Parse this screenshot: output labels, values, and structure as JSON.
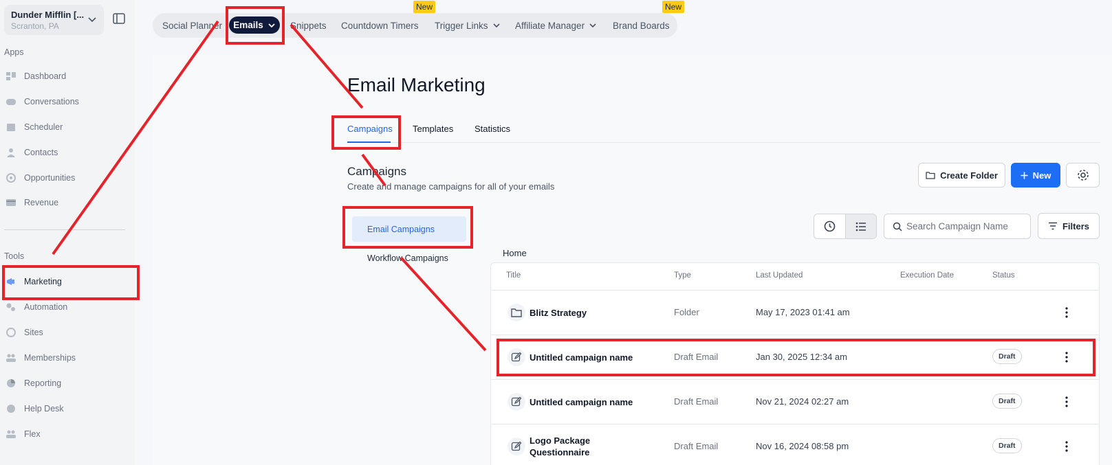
{
  "location": {
    "name": "Dunder Mifflin [...",
    "sub": "Scranton, PA"
  },
  "sidebar": {
    "apps_label": "Apps",
    "apps": [
      {
        "label": "Dashboard",
        "icon": "dashboard-icon"
      },
      {
        "label": "Conversations",
        "icon": "chat-icon"
      },
      {
        "label": "Scheduler",
        "icon": "calendar-icon"
      },
      {
        "label": "Contacts",
        "icon": "person-icon"
      },
      {
        "label": "Opportunities",
        "icon": "target-icon"
      },
      {
        "label": "Revenue",
        "icon": "card-icon"
      }
    ],
    "tools_label": "Tools",
    "tools": [
      {
        "label": "Marketing",
        "icon": "megaphone-icon"
      },
      {
        "label": "Automation",
        "icon": "gears-icon"
      },
      {
        "label": "Sites",
        "icon": "sites-icon"
      },
      {
        "label": "Memberships",
        "icon": "people-icon"
      },
      {
        "label": "Reporting",
        "icon": "pie-icon"
      },
      {
        "label": "Help Desk",
        "icon": "help-icon"
      },
      {
        "label": "Flex",
        "icon": "people-icon"
      }
    ]
  },
  "topnav": {
    "tabs": [
      "Social Planner",
      "Emails",
      "Snippets",
      "Countdown Timers",
      "Trigger Links",
      "Affiliate Manager",
      "Brand Boards"
    ],
    "badge": "New"
  },
  "page": {
    "title": "Email Marketing",
    "subtabs": [
      "Campaigns",
      "Templates",
      "Statistics"
    ],
    "section_title": "Campaigns",
    "section_sub": "Create and manage campaigns for all of your emails",
    "create_folder": "Create Folder",
    "new_label": "New",
    "side_nav": [
      "Email Campaigns",
      "Workflow Campaigns"
    ],
    "search_placeholder": "Search Campaign Name",
    "filters": "Filters",
    "breadcrumb": "Home"
  },
  "table": {
    "headers": [
      "Title",
      "Type",
      "Last Updated",
      "Execution Date",
      "Status"
    ],
    "rows": [
      {
        "title": "Blitz Strategy",
        "type": "Folder",
        "updated": "May 17, 2023 01:41 am",
        "status": "",
        "icon": "folder-icon"
      },
      {
        "title": "Untitled campaign name",
        "type": "Draft Email",
        "updated": "Jan 30, 2025 12:34 am",
        "status": "Draft",
        "icon": "edit-icon"
      },
      {
        "title": "Untitled campaign name",
        "type": "Draft Email",
        "updated": "Nov 21, 2024 02:27 am",
        "status": "Draft",
        "icon": "edit-icon"
      },
      {
        "title": "Logo Package Questionnaire",
        "type": "Draft Email",
        "updated": "Nov 16, 2024 08:58 pm",
        "status": "Draft",
        "icon": "edit-icon"
      }
    ]
  },
  "colors": {
    "accent": "#1d6ef5",
    "annotation": "#e3242b",
    "active_tab": "#101a3b"
  }
}
